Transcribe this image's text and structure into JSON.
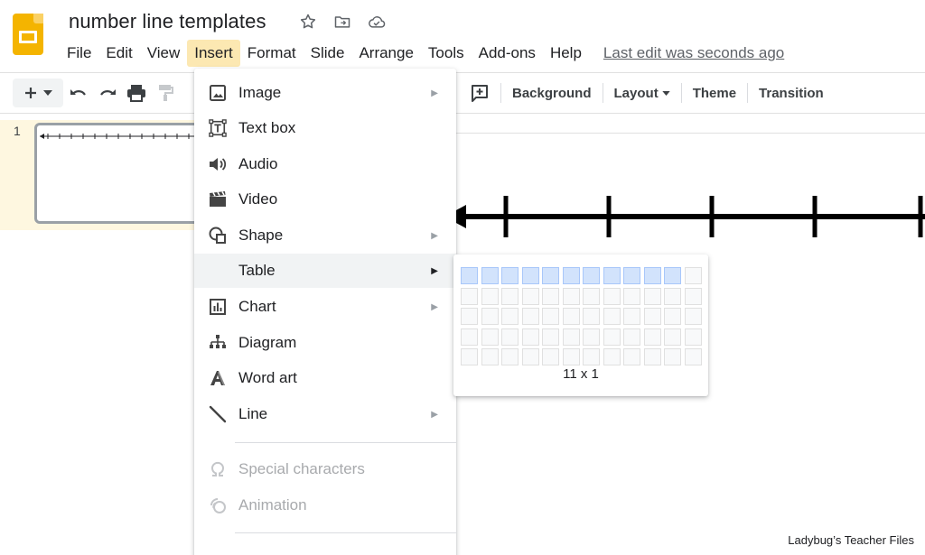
{
  "app": {
    "title": "number line templates",
    "last_edit": "Last edit was seconds ago",
    "accent": "#f4b400"
  },
  "menu": [
    {
      "label": "File"
    },
    {
      "label": "Edit"
    },
    {
      "label": "View"
    },
    {
      "label": "Insert"
    },
    {
      "label": "Format"
    },
    {
      "label": "Slide"
    },
    {
      "label": "Arrange"
    },
    {
      "label": "Tools"
    },
    {
      "label": "Add-ons"
    },
    {
      "label": "Help"
    }
  ],
  "toolbar": {
    "background": "Background",
    "layout": "Layout",
    "theme": "Theme",
    "transition": "Transition"
  },
  "filmstrip": {
    "slides": [
      {
        "number": "1"
      }
    ]
  },
  "insert_menu": {
    "items": [
      {
        "label": "Image",
        "icon": "image-icon",
        "submenu": true
      },
      {
        "label": "Text box",
        "icon": "text-box-icon",
        "submenu": false
      },
      {
        "label": "Audio",
        "icon": "audio-icon",
        "submenu": false
      },
      {
        "label": "Video",
        "icon": "video-icon",
        "submenu": false
      },
      {
        "label": "Shape",
        "icon": "shape-icon",
        "submenu": true
      },
      {
        "label": "Table",
        "icon": "",
        "submenu": true
      },
      {
        "label": "Chart",
        "icon": "chart-icon",
        "submenu": true
      },
      {
        "label": "Diagram",
        "icon": "diagram-icon",
        "submenu": false
      },
      {
        "label": "Word art",
        "icon": "word-art-icon",
        "submenu": false
      },
      {
        "label": "Line",
        "icon": "line-icon",
        "submenu": true
      }
    ],
    "disabled_items": [
      {
        "label": "Special characters",
        "icon": "omega-icon"
      },
      {
        "label": "Animation",
        "icon": "animation-icon"
      }
    ]
  },
  "table_picker": {
    "columns": 12,
    "rows": 5,
    "selected_columns": 11,
    "selected_rows": 1,
    "label": "11 x 1"
  },
  "watermark": "Ladybug’s Teacher Files"
}
